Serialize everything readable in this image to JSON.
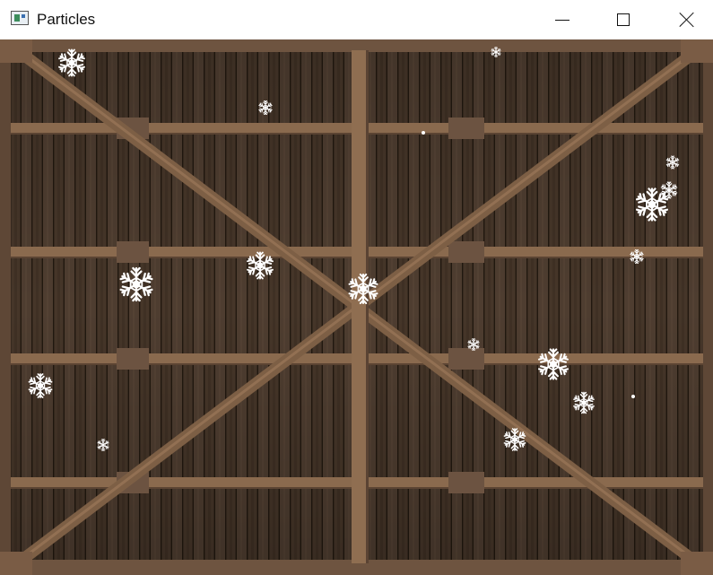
{
  "window": {
    "title": "Particles",
    "icon": "app-window-icon",
    "controls": [
      "minimize-icon",
      "maximize-icon",
      "close-icon"
    ]
  },
  "scene": {
    "background": "wooden-barn-door-with-cross-braces",
    "colors": {
      "wood_dark": "#3d3027",
      "wood_mid": "#4b3c31",
      "brace": "#8a6a4e",
      "snow": "#ffffff"
    }
  }
}
